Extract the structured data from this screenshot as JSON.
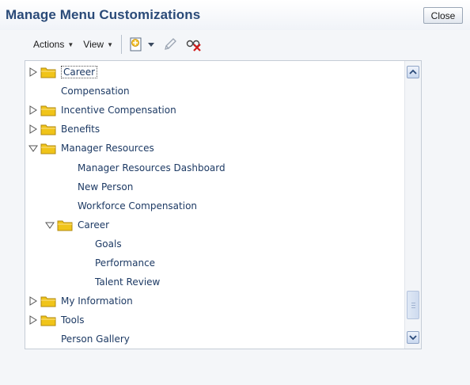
{
  "dialog": {
    "title": "Manage Menu Customizations",
    "close_label": "Close"
  },
  "toolbar": {
    "actions_label": "Actions",
    "view_label": "View",
    "icons": [
      "create-icon",
      "create-dropdown-icon",
      "edit-pencil-icon",
      "hide-delete-icon"
    ]
  },
  "tree": {
    "rows": [
      {
        "label": "Career",
        "level": 0,
        "type": "folder",
        "state": "collapsed",
        "selected": true
      },
      {
        "label": "Compensation",
        "level": 1,
        "type": "leaf"
      },
      {
        "label": "Incentive Compensation",
        "level": 0,
        "type": "folder",
        "state": "collapsed"
      },
      {
        "label": "Benefits",
        "level": 0,
        "type": "folder",
        "state": "collapsed"
      },
      {
        "label": "Manager Resources",
        "level": 0,
        "type": "folder",
        "state": "expanded"
      },
      {
        "label": "Manager Resources Dashboard",
        "level": 2,
        "type": "leaf"
      },
      {
        "label": "New Person",
        "level": 2,
        "type": "leaf"
      },
      {
        "label": "Workforce Compensation",
        "level": 2,
        "type": "leaf"
      },
      {
        "label": "Career",
        "level": 1,
        "type": "folder",
        "state": "expanded"
      },
      {
        "label": "Goals",
        "level": 3,
        "type": "leaf"
      },
      {
        "label": "Performance",
        "level": 3,
        "type": "leaf"
      },
      {
        "label": "Talent Review",
        "level": 3,
        "type": "leaf"
      },
      {
        "label": "My Information",
        "level": 0,
        "type": "folder",
        "state": "collapsed"
      },
      {
        "label": "Tools",
        "level": 0,
        "type": "folder",
        "state": "collapsed"
      },
      {
        "label": "Person Gallery",
        "level": 1,
        "type": "leaf"
      }
    ]
  },
  "colors": {
    "title": "#2a4a78",
    "link": "#1d3a64",
    "folder": "#f0c419"
  }
}
